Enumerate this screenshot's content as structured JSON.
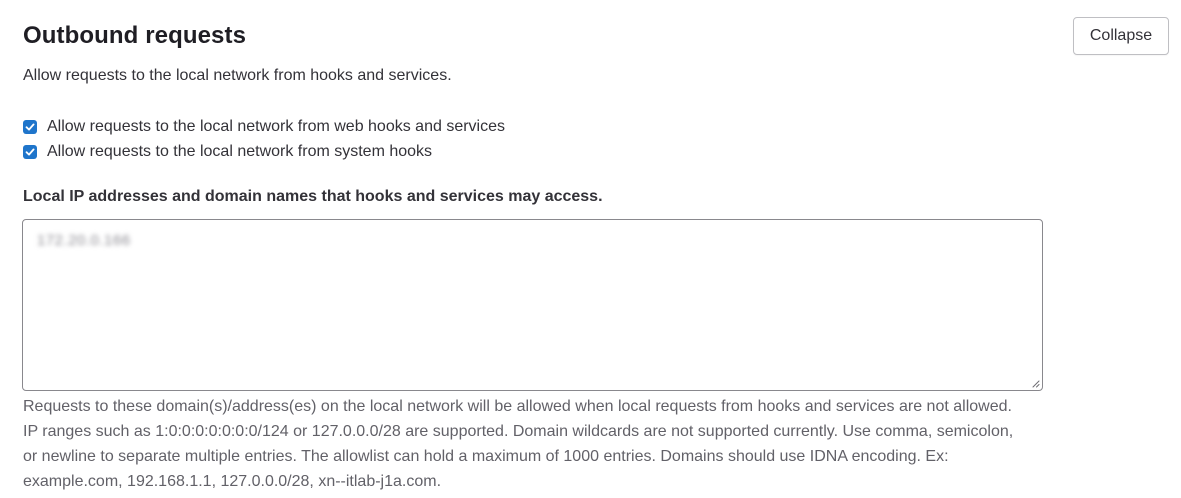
{
  "section": {
    "title": "Outbound requests",
    "collapse_label": "Collapse",
    "description": "Allow requests to the local network from hooks and services."
  },
  "checkboxes": [
    {
      "label": "Allow requests to the local network from web hooks and services",
      "checked": true
    },
    {
      "label": "Allow requests to the local network from system hooks",
      "checked": true
    }
  ],
  "allowlist": {
    "label": "Local IP addresses and domain names that hooks and services may access.",
    "value": "172.20.0.166",
    "help": "Requests to these domain(s)/address(es) on the local network will be allowed when local requests from hooks and services are not allowed. IP ranges such as 1:0:0:0:0:0:0:0/124 or 127.0.0.0/28 are supported. Domain wildcards are not supported currently. Use comma, semicolon, or newline to separate multiple entries. The allowlist can hold a maximum of 1000 entries. Domains should use IDNA encoding. Ex: example.com, 192.168.1.1, 127.0.0.0/28, xn--itlab-j1a.com."
  },
  "colors": {
    "checkbox_accent": "#1f75cb",
    "heading_text": "#1f1e24",
    "body_text": "#333238",
    "help_text": "#626168",
    "input_border": "#89888d"
  },
  "icons": {
    "checkmark": "check-icon",
    "resize": "resize-handle-icon"
  }
}
